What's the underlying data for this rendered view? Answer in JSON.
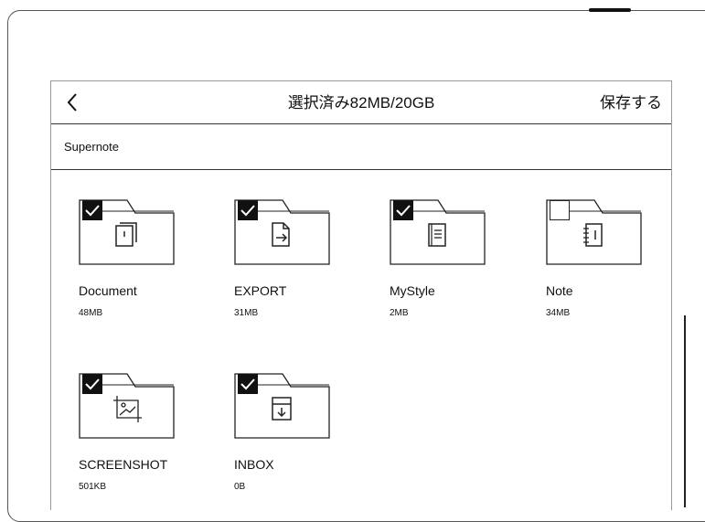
{
  "header": {
    "back_icon": "chevron-left-icon",
    "title": "選択済み82MB/20GB",
    "save_label": "保存する"
  },
  "breadcrumb": {
    "path": "Supernote"
  },
  "folders": [
    {
      "name": "Document",
      "size": "48MB",
      "checked": true,
      "icon": "document-stack-icon"
    },
    {
      "name": "EXPORT",
      "size": "31MB",
      "checked": true,
      "icon": "file-export-icon"
    },
    {
      "name": "MyStyle",
      "size": "2MB",
      "checked": true,
      "icon": "template-icon"
    },
    {
      "name": "Note",
      "size": "34MB",
      "checked": false,
      "icon": "notebook-icon"
    },
    {
      "name": "SCREENSHOT",
      "size": "501KB",
      "checked": true,
      "icon": "screenshot-icon"
    },
    {
      "name": "INBOX",
      "size": "0B",
      "checked": true,
      "icon": "inbox-icon"
    }
  ]
}
